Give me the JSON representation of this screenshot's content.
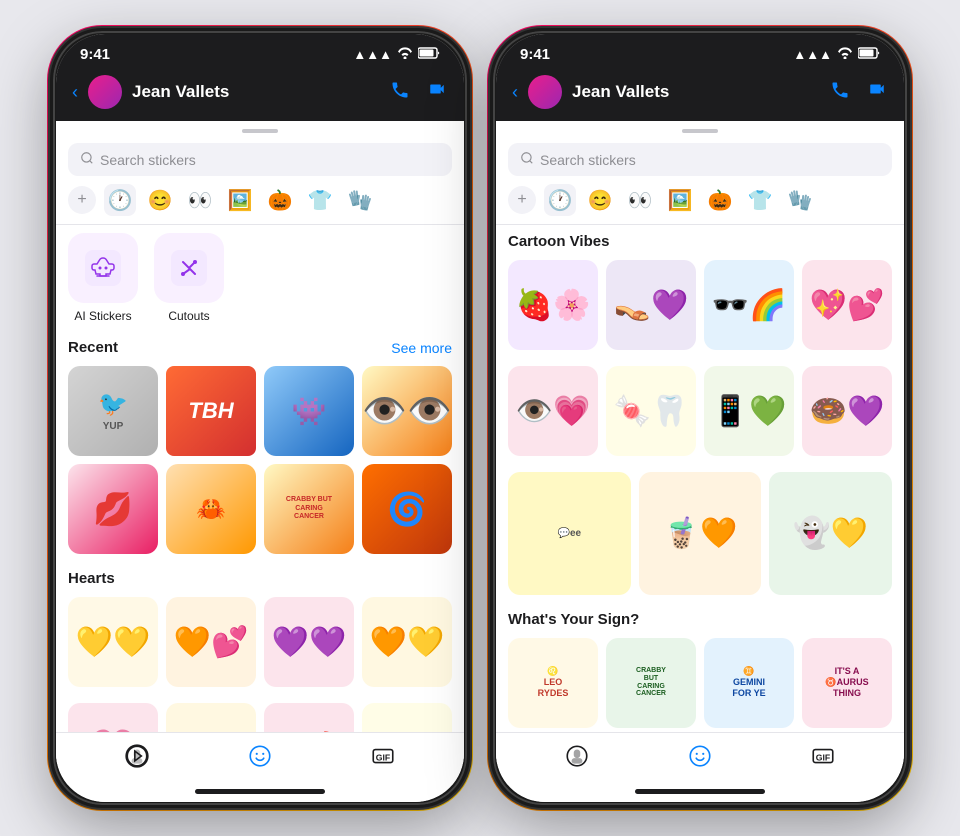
{
  "phone1": {
    "statusBar": {
      "time": "9:41",
      "signal": "▲▲▲",
      "wifi": "wifi",
      "battery": "battery"
    },
    "nav": {
      "backLabel": "‹",
      "title": "Jean Vallets",
      "callIcon": "📞",
      "videoIcon": "📷"
    },
    "search": {
      "placeholder": "Search stickers",
      "icon": "🔍"
    },
    "tabs": {
      "addLabel": "+",
      "icons": [
        "🕐",
        "😊",
        "👀",
        "🖼️",
        "🎃",
        "👕",
        "🧤"
      ]
    },
    "aiSection": {
      "items": [
        {
          "label": "AI Stickers",
          "icon": "✂️"
        },
        {
          "label": "Cutouts",
          "icon": "✂️"
        }
      ]
    },
    "recent": {
      "title": "Recent",
      "seeMore": "See more"
    },
    "hearts": {
      "title": "Hearts"
    },
    "toolbar": {
      "items": [
        "mask",
        "sticker",
        "gif"
      ]
    }
  },
  "phone2": {
    "statusBar": {
      "time": "9:41"
    },
    "nav": {
      "title": "Jean Vallets"
    },
    "search": {
      "placeholder": "Search stickers"
    },
    "sections": {
      "cartoonVibes": "Cartoon Vibes",
      "whatsYourSign": "What's Your Sign?"
    }
  },
  "colors": {
    "accent": "#0a84ff",
    "navBg": "#1c1c1e",
    "gradientStart": "#ff006e",
    "gradientEnd": "#ff6b00"
  }
}
